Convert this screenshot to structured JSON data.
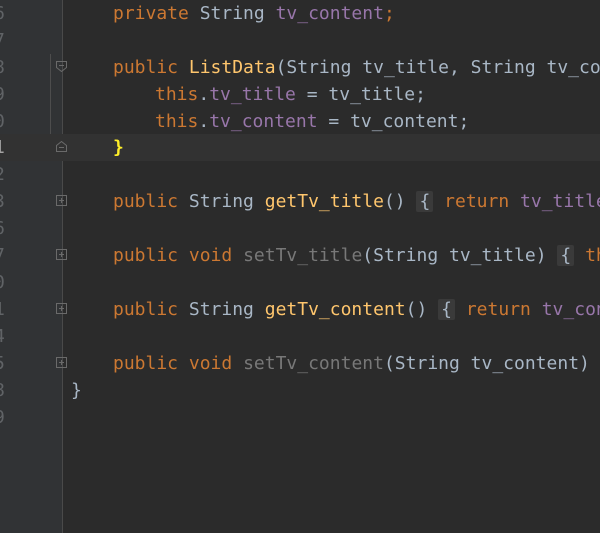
{
  "line_numbers": [
    "6",
    "7",
    "8",
    "9",
    "0",
    "1",
    "2",
    "3",
    "6",
    "7",
    "0",
    "1",
    "4",
    "5",
    "8",
    "9"
  ],
  "code": {
    "l6": {
      "kw": "private",
      "t1": " String ",
      "fld": "tv_content",
      "t2": ";"
    },
    "l8": {
      "kw": "public",
      "t1": " ",
      "fn": "ListData",
      "t2": "(String tv_title, String tv_cont"
    },
    "l9": {
      "kw": "this",
      "t1": ".",
      "fld": "tv_title",
      "t2": " = tv_title;"
    },
    "l0": {
      "kw": "this",
      "t1": ".",
      "fld": "tv_content",
      "t2": " = tv_content;"
    },
    "l1": {
      "brace": "}"
    },
    "l3": {
      "kw": "public",
      "t1": " String ",
      "fn": "getTv_title",
      "t2": "()",
      "box": "{",
      "kw2": "return",
      "fld": "tv_title",
      "t3": ";"
    },
    "l7": {
      "kw": "public",
      "kw2": "void",
      "fn": "setTv_title",
      "t2": "(String tv_title)",
      "box": "{",
      "kw3": "this"
    },
    "l1b": {
      "kw": "public",
      "t1": " String ",
      "fn": "getTv_content",
      "t2": "()",
      "box": "{",
      "kw2": "return",
      "fld": "tv_conte"
    },
    "l5": {
      "kw": "public",
      "kw2": "void",
      "fn": "setTv_content",
      "t2": "(String tv_content)",
      "box": "{"
    },
    "l8b": {
      "brace": "}"
    }
  },
  "colors": {
    "background": "#2b2b2b",
    "keyword": "#cc7832",
    "method": "#ffc66d",
    "field": "#9876aa",
    "text": "#a9b7c6",
    "brace_highlight": "#ffef28"
  }
}
